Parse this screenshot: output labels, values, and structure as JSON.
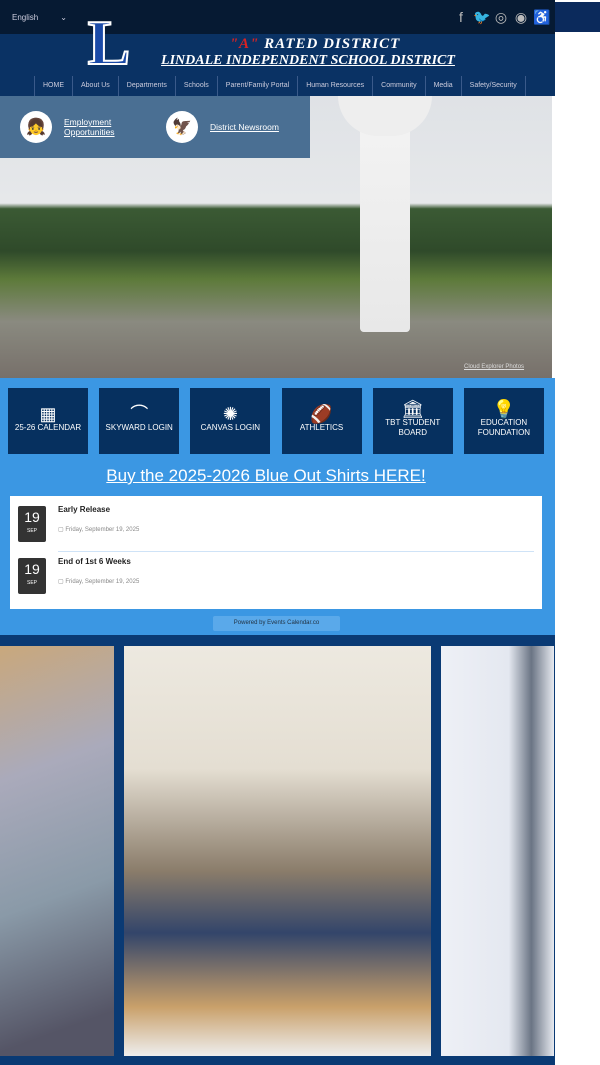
{
  "topbar": {
    "language": "English",
    "social": [
      "facebook-icon",
      "twitter-icon",
      "instagram-icon",
      "app-icon",
      "accessibility-icon"
    ]
  },
  "header": {
    "logo_letter": "L",
    "rated_quote": "\"A\"",
    "rated_text": "RATED DISTRICT",
    "district": "LINDALE INDEPENDENT SCHOOL DISTRICT"
  },
  "nav": [
    "HOME",
    "About Us",
    "Departments",
    "Schools",
    "Parent/Family Portal",
    "Human Resources",
    "Community",
    "Media",
    "Safety/Security"
  ],
  "quick": [
    {
      "label": "Employment Opportunities"
    },
    {
      "label": "District Newsroom"
    }
  ],
  "hero": {
    "credit": "Cloud Explorer Photos"
  },
  "tiles": [
    {
      "label": "25-26 CALENDAR"
    },
    {
      "label": "SKYWARD LOGIN"
    },
    {
      "label": "CANVAS LOGIN"
    },
    {
      "label": "ATHLETICS"
    },
    {
      "label": "TBT STUDENT BOARD"
    },
    {
      "label": "EDUCATION FOUNDATION"
    }
  ],
  "buy": "Buy the 2025-2026 Blue Out Shirts HERE!",
  "events": [
    {
      "day": "19",
      "month": "SEP",
      "title": "Early Release",
      "date": "Friday, September 19, 2025"
    },
    {
      "day": "19",
      "month": "SEP",
      "title": "End of 1st 6 Weeks",
      "date": "Friday, September 19, 2025"
    }
  ],
  "powered": "Powered by Events Calendar.co"
}
